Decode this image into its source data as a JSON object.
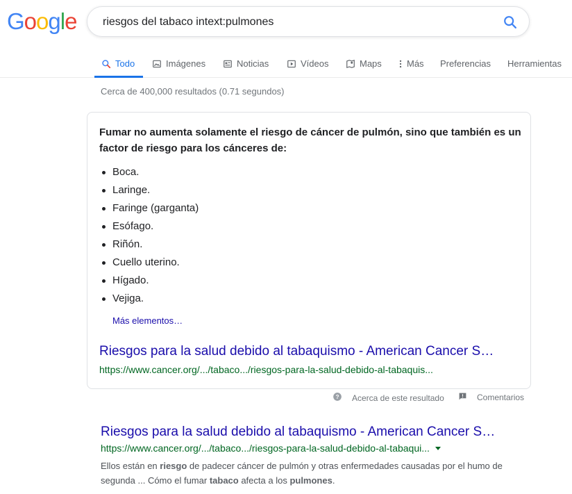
{
  "logo": {
    "letters": [
      {
        "ch": "G",
        "color": "#4285F4"
      },
      {
        "ch": "o",
        "color": "#EA4335"
      },
      {
        "ch": "o",
        "color": "#FBBC05"
      },
      {
        "ch": "g",
        "color": "#4285F4"
      },
      {
        "ch": "l",
        "color": "#34A853"
      },
      {
        "ch": "e",
        "color": "#EA4335"
      }
    ]
  },
  "search": {
    "value": "riesgos del tabaco intext:pulmones",
    "icon": "search-icon",
    "accent": "#4285F4"
  },
  "tabs": [
    {
      "label": "Todo",
      "icon": "search-icon",
      "active": true
    },
    {
      "label": "Imágenes",
      "icon": "image-icon"
    },
    {
      "label": "Noticias",
      "icon": "news-icon"
    },
    {
      "label": "Vídeos",
      "icon": "video-icon"
    },
    {
      "label": "Maps",
      "icon": "map-pin-icon"
    },
    {
      "label": "Más",
      "icon": "more-vert-icon"
    },
    {
      "label": "Preferencias"
    },
    {
      "label": "Herramientas"
    }
  ],
  "stats": "Cerca de 400,000 resultados (0.71 segundos)",
  "featured": {
    "heading": "Fumar no aumenta solamente el riesgo de cáncer de pulmón, sino que también es un factor de riesgo para los cánceres de:",
    "items": [
      "Boca.",
      "Laringe.",
      "Faringe (garganta)",
      "Esófago.",
      "Riñón.",
      "Cuello uterino.",
      "Hígado.",
      "Vejiga."
    ],
    "more_label": "Más elementos…",
    "title": "Riesgos para la salud debido al tabaquismo - American Cancer S…",
    "url": "https://www.cancer.org/.../tabaco.../riesgos-para-la-salud-debido-al-tabaquis..."
  },
  "about": {
    "label": "Acerca de este resultado",
    "icon": "help-icon"
  },
  "feedback": {
    "label": "Comentarios",
    "icon": "feedback-icon"
  },
  "result": {
    "title": "Riesgos para la salud debido al tabaquismo - American Cancer S…",
    "url": "https://www.cancer.org/.../tabaco.../riesgos-para-la-salud-debido-al-tabaqui...",
    "snippet_1": "Ellos están en ",
    "snippet_b1": "riesgo",
    "snippet_2": " de padecer cáncer de pulmón y otras enfermedades causadas por el humo de segunda ... Cómo el fumar ",
    "snippet_b2": "tabaco",
    "snippet_3": " afecta a los ",
    "snippet_b3": "pulmones",
    "snippet_4": "."
  }
}
